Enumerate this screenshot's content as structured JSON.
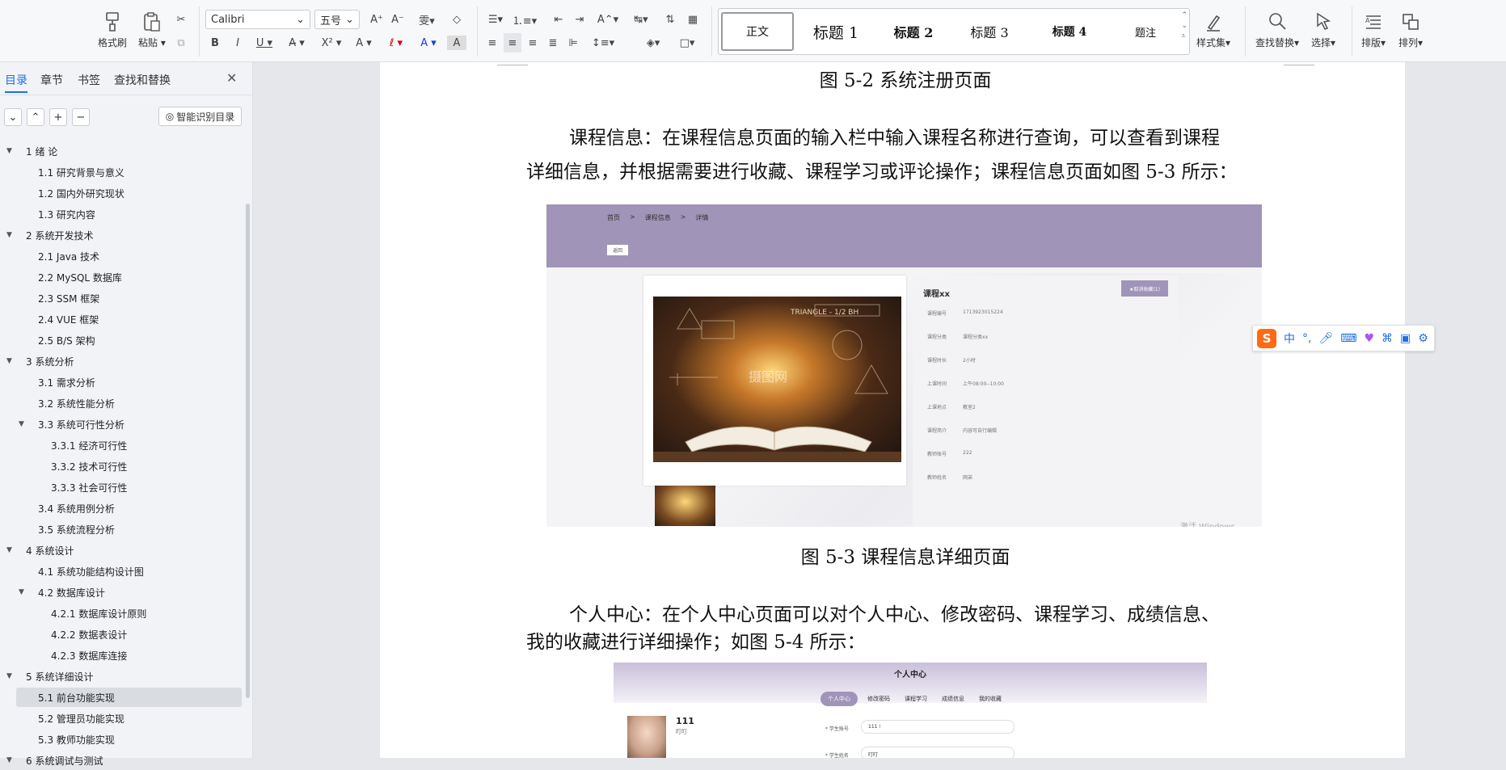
{
  "ribbon": {
    "format_painter": "格式刷",
    "paste": "粘贴",
    "font_name": "Calibri",
    "font_size": "五号",
    "styles": [
      "正文",
      "标题 1",
      "标题 2",
      "标题 3",
      "标题 4",
      "题注"
    ],
    "style_set": "样式集",
    "find_replace": "查找替换",
    "select": "选择",
    "layout": "排版",
    "arrange": "排列"
  },
  "nav": {
    "tabs": [
      "目录",
      "章节",
      "书签",
      "查找和替换"
    ],
    "smart_toc": "智能识别目录",
    "toc": [
      {
        "label": "1  绪    论",
        "level": 1,
        "expandable": true
      },
      {
        "label": "1.1 研究背景与意义",
        "level": 2
      },
      {
        "label": "1.2 国内外研究现状",
        "level": 2
      },
      {
        "label": "1.3 研究内容",
        "level": 2
      },
      {
        "label": "2 系统开发技术",
        "level": 1,
        "expandable": true
      },
      {
        "label": "2.1 Java 技术",
        "level": 2
      },
      {
        "label": "2.2 MySQL 数据库",
        "level": 2
      },
      {
        "label": "2.3 SSM 框架",
        "level": 2
      },
      {
        "label": "2.4 VUE 框架",
        "level": 2
      },
      {
        "label": "2.5 B/S 架构",
        "level": 2
      },
      {
        "label": "3 系统分析",
        "level": 1,
        "expandable": true
      },
      {
        "label": "3.1 需求分析",
        "level": 2
      },
      {
        "label": "3.2 系统性能分析",
        "level": 2
      },
      {
        "label": "3.3 系统可行性分析",
        "level": 2,
        "expandable": true
      },
      {
        "label": "3.3.1 经济可行性",
        "level": 3
      },
      {
        "label": "3.3.2 技术可行性",
        "level": 3
      },
      {
        "label": "3.3.3 社会可行性",
        "level": 3
      },
      {
        "label": "3.4 系统用例分析",
        "level": 2
      },
      {
        "label": "3.5  系统流程分析",
        "level": 2
      },
      {
        "label": "4  系统设计",
        "level": 1,
        "expandable": true
      },
      {
        "label": "4.1 系统功能结构设计图",
        "level": 2
      },
      {
        "label": "4.2 数据库设计",
        "level": 2,
        "expandable": true
      },
      {
        "label": "4.2.1 数据库设计原则",
        "level": 3
      },
      {
        "label": "4.2.2  数据表设计",
        "level": 3
      },
      {
        "label": "4.2.3 数据库连接",
        "level": 3
      },
      {
        "label": "5 系统详细设计",
        "level": 1,
        "expandable": true
      },
      {
        "label": "5.1 前台功能实现",
        "level": 2,
        "selected": true
      },
      {
        "label": "5.2 管理员功能实现",
        "level": 2
      },
      {
        "label": "5.3 教师功能实现",
        "level": 2
      },
      {
        "label": "6  系统调试与测试",
        "level": 1,
        "expandable": true
      }
    ]
  },
  "doc": {
    "caption_52": "图 5-2 系统注册页面",
    "para_course_1": "课程信息：在课程信息页面的输入栏中输入课程名称进行查询，可以查看到课程",
    "para_course_2": "详细信息，并根据需要进行收藏、课程学习或评论操作；课程信息页面如图 5-3 所示：",
    "caption_53": "图 5-3 课程信息详细页面",
    "para_personal_1": "个人中心：在个人中心页面可以对个人中心、修改密码、课程学习、成绩信息、",
    "para_personal_2": "我的收藏进行详细操作；如图 5-4 所示："
  },
  "fig53": {
    "breadcrumb": [
      "首页",
      ">",
      "课程信息",
      ">",
      "详情"
    ],
    "back": "返回",
    "title": "课程xx",
    "fav_button": "★取消收藏(1)",
    "fields": [
      {
        "k": "课程编号",
        "v": "1713923015224"
      },
      {
        "k": "课程分类",
        "v": "课程分类xx"
      },
      {
        "k": "课程时长",
        "v": "2小时"
      },
      {
        "k": "上课时间",
        "v": "上午08:00--10:00"
      },
      {
        "k": "上课地点",
        "v": "教室2"
      },
      {
        "k": "课程简介",
        "v": "内容可自行编辑"
      },
      {
        "k": "教师账号",
        "v": "222"
      },
      {
        "k": "教师姓名",
        "v": "网弟"
      }
    ],
    "watermark": "摄图网",
    "activate": "激活 Windows",
    "board_text": "TRIANGLE - 1/2 BH"
  },
  "fig54": {
    "title": "个人中心",
    "tabs": [
      "个人中心",
      "修改密码",
      "课程学习",
      "成绩信息",
      "我的收藏"
    ],
    "user": "111",
    "user_sub": "叮叮",
    "field1_label": "* 学生账号",
    "field1_value": "111",
    "field2_label": "* 学生姓名",
    "field2_value": "叮叮"
  },
  "ime": {
    "label": "中"
  }
}
